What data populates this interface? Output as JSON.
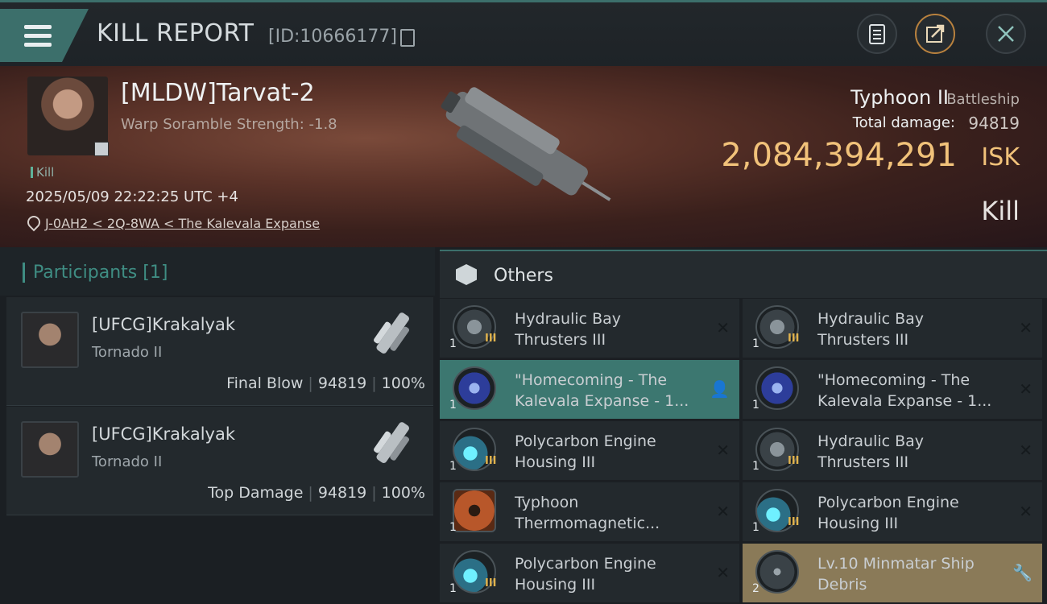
{
  "header": {
    "title": "KILL REPORT",
    "report_id": "[ID:10666177]"
  },
  "victim": {
    "name": "[MLDW]Tarvat-2",
    "subtitle": "Warp Soramble Strength: -1.8",
    "tag": "Kill",
    "datetime": "2025/05/09 22:22:25 UTC +4",
    "location": "J-0AH2 < 2Q-8WA < The Kalevala Expanse",
    "ship_name": "Typhoon II",
    "ship_class": "Battleship",
    "total_damage_label": "Total damage:",
    "total_damage": "94819",
    "isk_value": "2,084,394,291",
    "isk_unit": "ISK",
    "result": "Kill"
  },
  "participants": {
    "title": "Participants",
    "count": "[1]",
    "cards": [
      {
        "name": "[UFCG]Krakalyak",
        "ship": "Tornado II",
        "role": "Final Blow",
        "damage": "94819",
        "percent": "100%"
      },
      {
        "name": "[UFCG]Krakalyak",
        "ship": "Tornado II",
        "role": "Top Damage",
        "damage": "94819",
        "percent": "100%"
      }
    ]
  },
  "others": {
    "title": "Others",
    "items": [
      {
        "name_l1": "Hydraulic Bay",
        "name_l2": "Thrusters III",
        "qty": "1",
        "tier": "III"
      },
      {
        "name_l1": "Hydraulic Bay",
        "name_l2": "Thrusters III",
        "qty": "1",
        "tier": "III"
      },
      {
        "name_l1": "\"Homecoming - The",
        "name_l2": "Kalevala Expanse - 1...",
        "qty": "1",
        "tier": ""
      },
      {
        "name_l1": "\"Homecoming - The",
        "name_l2": "Kalevala Expanse - 1...",
        "qty": "1",
        "tier": ""
      },
      {
        "name_l1": "Polycarbon Engine",
        "name_l2": "Housing III",
        "qty": "1",
        "tier": "III"
      },
      {
        "name_l1": "Hydraulic Bay",
        "name_l2": "Thrusters III",
        "qty": "1",
        "tier": "III"
      },
      {
        "name_l1": "Typhoon",
        "name_l2": "Thermomagnetic...",
        "qty": "1",
        "tier": ""
      },
      {
        "name_l1": "Polycarbon Engine",
        "name_l2": "Housing III",
        "qty": "1",
        "tier": "III"
      },
      {
        "name_l1": "Polycarbon Engine",
        "name_l2": "Housing III",
        "qty": "1",
        "tier": "III"
      },
      {
        "name_l1": "Lv.10 Minmatar Ship",
        "name_l2": "Debris",
        "qty": "2",
        "tier": ""
      }
    ]
  },
  "colors": {
    "accent": "#3c6f6b",
    "isk": "#f1c27a",
    "highlight_teal": "#3c7770",
    "highlight_gold": "#8a7a58"
  }
}
